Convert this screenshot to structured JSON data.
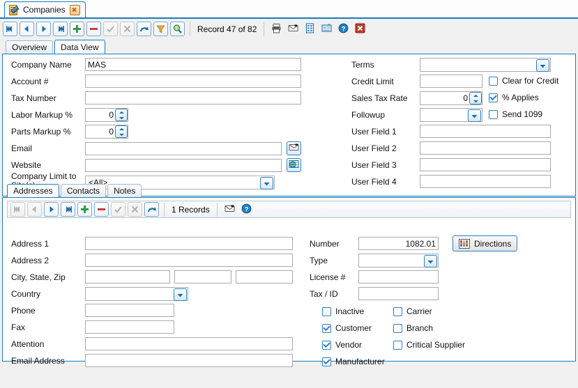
{
  "window": {
    "tab_label": "Companies",
    "tab_icon": "document-edit-icon",
    "close_icon": "close-icon"
  },
  "toolbar": {
    "buttons": [
      {
        "name": "first-record-button",
        "icon": "skip-first-icon",
        "enabled": true
      },
      {
        "name": "previous-record-button",
        "icon": "triangle-left-icon",
        "enabled": true
      },
      {
        "name": "next-record-button",
        "icon": "triangle-right-icon",
        "enabled": true
      },
      {
        "name": "last-record-button",
        "icon": "skip-last-icon",
        "enabled": true
      },
      {
        "name": "add-record-button",
        "icon": "plus-icon",
        "enabled": true
      },
      {
        "name": "delete-record-button",
        "icon": "minus-icon",
        "enabled": true
      },
      {
        "name": "accept-button",
        "icon": "check-icon",
        "enabled": false
      },
      {
        "name": "cancel-button",
        "icon": "x-icon",
        "enabled": false
      },
      {
        "name": "refresh-button",
        "icon": "refresh-arrow-icon",
        "enabled": true
      },
      {
        "name": "filter-button",
        "icon": "funnel-icon",
        "enabled": true
      },
      {
        "name": "search-button",
        "icon": "magnifier-icon",
        "enabled": true
      }
    ],
    "record_status": "Record 47 of 82",
    "actions": [
      {
        "name": "print-button",
        "icon": "printer-icon"
      },
      {
        "name": "email-button",
        "icon": "envelope-icon"
      },
      {
        "name": "report-button",
        "icon": "report-icon"
      },
      {
        "name": "card-view-button",
        "icon": "card-icon"
      },
      {
        "name": "help-button",
        "icon": "help-icon"
      },
      {
        "name": "close-window-button",
        "icon": "close-red-icon"
      }
    ]
  },
  "view_tabs": [
    {
      "label": "Overview",
      "active": false
    },
    {
      "label": "Data View",
      "active": true
    }
  ],
  "company_form": {
    "left": [
      {
        "label": "Company Name",
        "value": "MAS",
        "type": "text",
        "name": "company-name-input"
      },
      {
        "label": "Account #",
        "value": "",
        "type": "text",
        "name": "account-number-input"
      },
      {
        "label": "Tax Number",
        "value": "",
        "type": "text",
        "name": "tax-number-input"
      },
      {
        "label": "Labor Markup %",
        "value": "0",
        "type": "spinner",
        "name": "labor-markup-input"
      },
      {
        "label": "Parts Markup %",
        "value": "0",
        "type": "spinner",
        "name": "parts-markup-input"
      },
      {
        "label": "Email",
        "value": "",
        "type": "text-icon",
        "name": "email-input",
        "icon": "envelope-icon"
      },
      {
        "label": "Website",
        "value": "",
        "type": "text-icon",
        "name": "website-input",
        "icon": "globe-icon"
      },
      {
        "label": "Company Limit to Site(s)",
        "value": "<All>",
        "type": "combo",
        "name": "company-limit-to-sites-combo"
      }
    ],
    "right": [
      {
        "label": "Terms",
        "value": "",
        "type": "combo",
        "name": "terms-combo"
      },
      {
        "label": "Credit Limit",
        "value": "",
        "type": "text",
        "name": "credit-limit-input"
      },
      {
        "label": "Sales Tax Rate",
        "value": "0",
        "type": "spinner",
        "name": "sales-tax-rate-input"
      },
      {
        "label": "Followup",
        "value": "",
        "type": "combo",
        "name": "followup-combo"
      },
      {
        "label": "User Field 1",
        "value": "",
        "type": "text",
        "name": "user-field-1-input"
      },
      {
        "label": "User Field 2",
        "value": "",
        "type": "text",
        "name": "user-field-2-input"
      },
      {
        "label": "User Field 3",
        "value": "",
        "type": "text",
        "name": "user-field-3-input"
      },
      {
        "label": "User Field 4",
        "value": "",
        "type": "text",
        "name": "user-field-4-input"
      }
    ],
    "checkboxes": [
      {
        "label": "Clear for Credit",
        "checked": false,
        "name": "clear-for-credit-checkbox"
      },
      {
        "label": "% Applies",
        "checked": true,
        "name": "percent-applies-checkbox"
      },
      {
        "label": "Send 1099",
        "checked": false,
        "name": "send-1099-checkbox"
      }
    ]
  },
  "sub_tabs": [
    {
      "label": "Addresses",
      "active": true
    },
    {
      "label": "Contacts",
      "active": false
    },
    {
      "label": "Notes",
      "active": false
    }
  ],
  "sub_toolbar": {
    "buttons": [
      {
        "name": "address-first-button",
        "icon": "skip-first-icon",
        "enabled": false
      },
      {
        "name": "address-previous-button",
        "icon": "triangle-left-icon",
        "enabled": false
      },
      {
        "name": "address-next-button",
        "icon": "triangle-right-icon",
        "enabled": true
      },
      {
        "name": "address-last-button",
        "icon": "skip-last-icon",
        "enabled": true
      },
      {
        "name": "address-add-button",
        "icon": "plus-icon",
        "enabled": true
      },
      {
        "name": "address-delete-button",
        "icon": "minus-icon",
        "enabled": true
      },
      {
        "name": "address-accept-button",
        "icon": "check-icon",
        "enabled": false
      },
      {
        "name": "address-cancel-button",
        "icon": "x-icon",
        "enabled": false
      },
      {
        "name": "address-refresh-button",
        "icon": "refresh-arrow-icon",
        "enabled": true
      }
    ],
    "record_count": "1 Records",
    "actions": [
      {
        "name": "address-email-button",
        "icon": "envelope-icon"
      },
      {
        "name": "address-help-button",
        "icon": "help-icon"
      }
    ]
  },
  "address_form": {
    "left": [
      {
        "label": "Address 1",
        "value": "",
        "type": "text",
        "name": "address-1-input"
      },
      {
        "label": "Address 2",
        "value": "",
        "type": "text",
        "name": "address-2-input"
      },
      {
        "label": "City, State, Zip",
        "value": "",
        "type": "triple",
        "name": "city-state-zip-input"
      },
      {
        "label": "Country",
        "value": "",
        "type": "combo",
        "name": "country-combo"
      },
      {
        "label": "Phone",
        "value": "",
        "type": "text",
        "name": "phone-input"
      },
      {
        "label": "Fax",
        "value": "",
        "type": "text",
        "name": "fax-input"
      },
      {
        "label": "Attention",
        "value": "",
        "type": "text",
        "name": "attention-input"
      },
      {
        "label": "Email Address",
        "value": "",
        "type": "text",
        "name": "email-address-input"
      }
    ],
    "city_value": "",
    "state_value": "",
    "zip_value": "",
    "right": [
      {
        "label": "Number",
        "value": "1082.01",
        "type": "text-num",
        "name": "number-input"
      },
      {
        "label": "Type",
        "value": "",
        "type": "combo",
        "name": "type-combo"
      },
      {
        "label": "License #",
        "value": "",
        "type": "text",
        "name": "license-number-input"
      },
      {
        "label": "Tax / ID",
        "value": "",
        "type": "text",
        "name": "tax-id-input"
      }
    ],
    "directions_button": "Directions",
    "flags_col1": [
      {
        "label": "Inactive",
        "checked": false,
        "name": "inactive-checkbox"
      },
      {
        "label": "Customer",
        "checked": true,
        "name": "customer-checkbox"
      },
      {
        "label": "Vendor",
        "checked": true,
        "name": "vendor-checkbox"
      },
      {
        "label": "Manufacturer",
        "checked": true,
        "name": "manufacturer-checkbox"
      }
    ],
    "flags_col2": [
      {
        "label": "Carrier",
        "checked": false,
        "name": "carrier-checkbox"
      },
      {
        "label": "Branch",
        "checked": false,
        "name": "branch-checkbox"
      },
      {
        "label": "Critical Supplier",
        "checked": false,
        "name": "critical-supplier-checkbox"
      }
    ]
  },
  "colors": {
    "accent": "#1a7bb9",
    "panel_bg": "#ffffff",
    "app_bg": "#f0f0f0",
    "button_border": "#2f7fbf",
    "add_green": "#2e9b4e",
    "delete_red": "#d03a3a"
  }
}
